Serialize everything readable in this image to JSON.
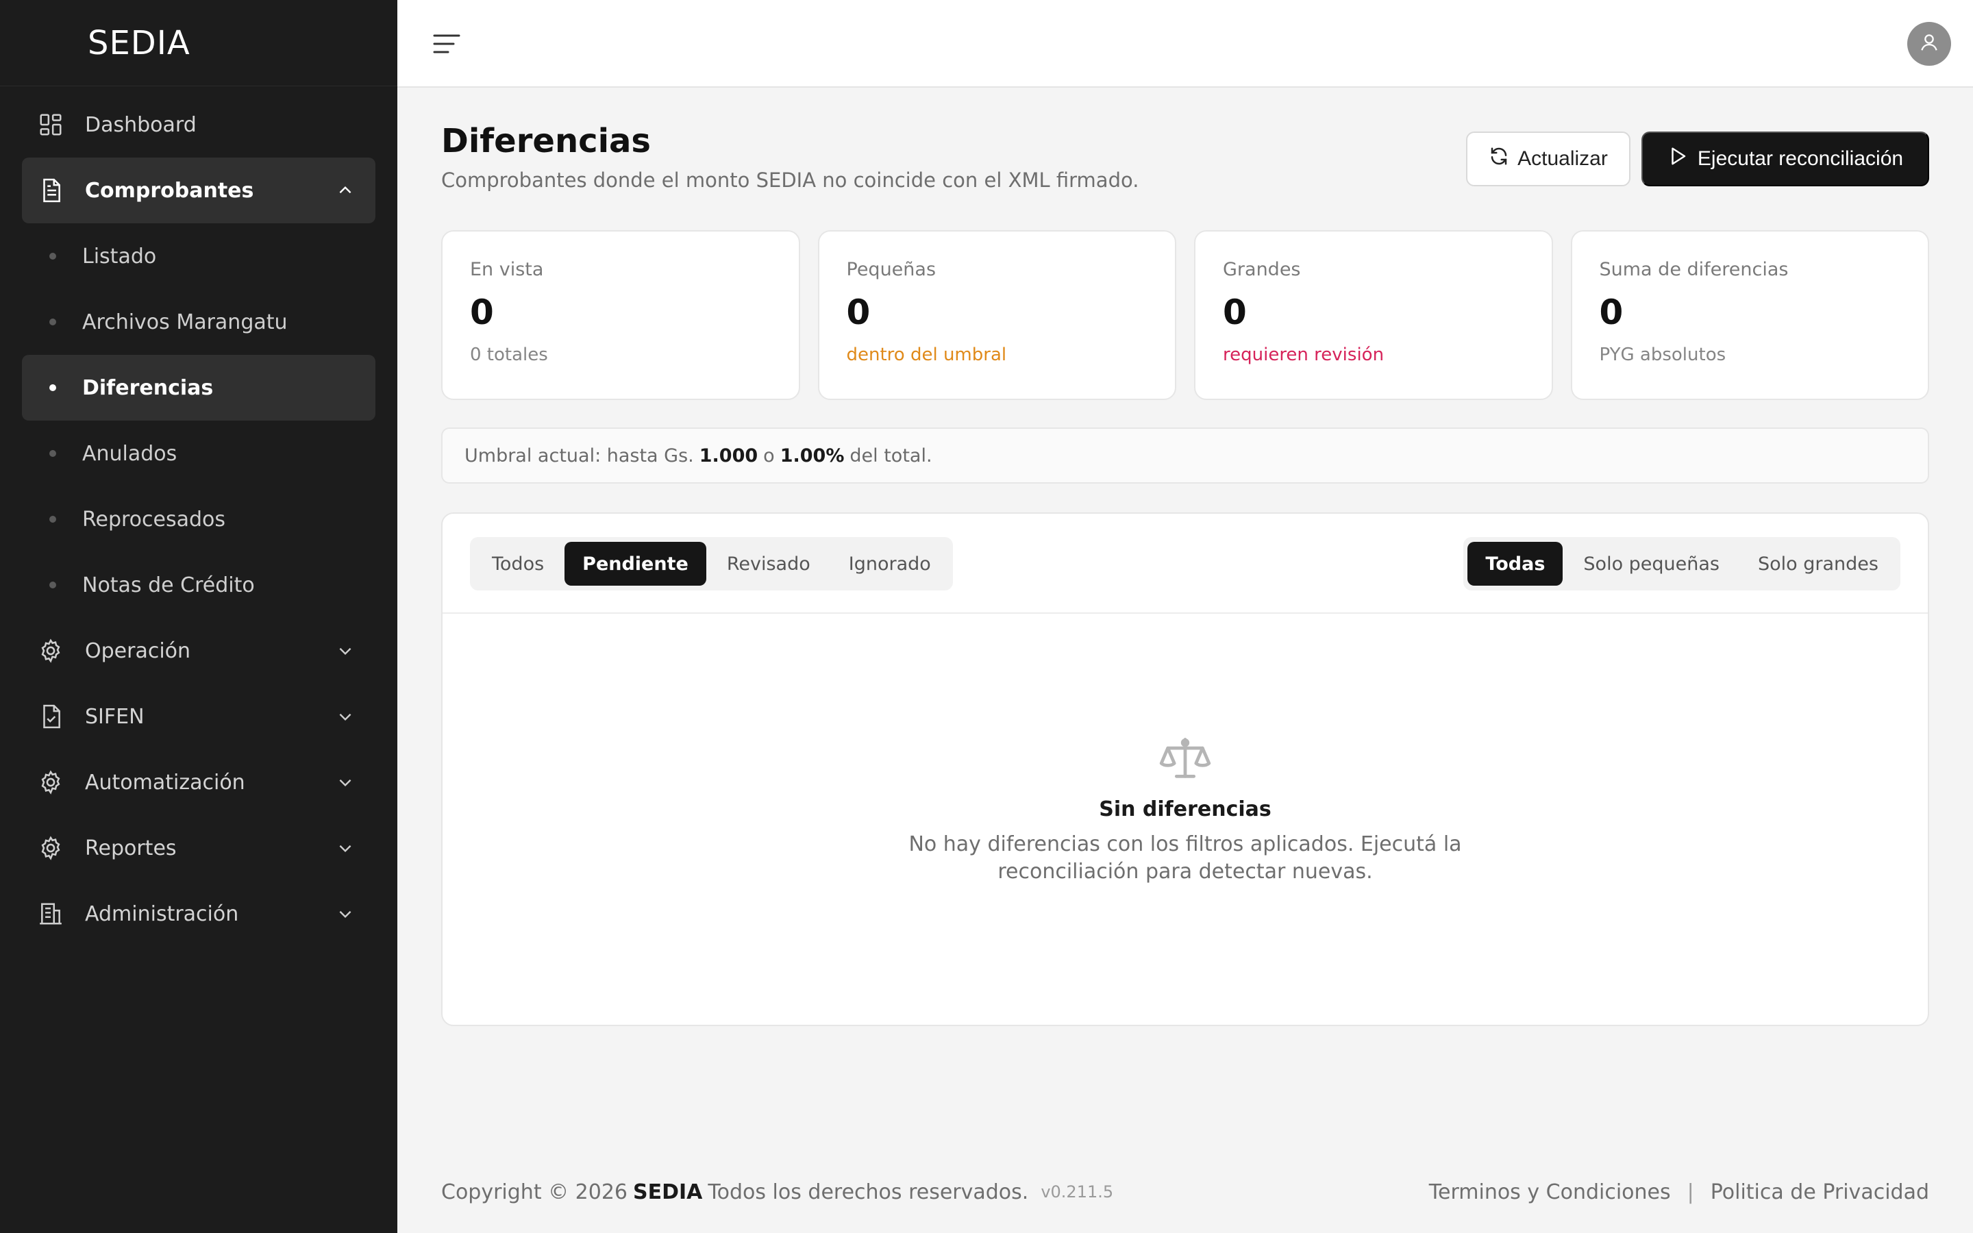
{
  "sidebar": {
    "brand": "SEDIA",
    "items": {
      "dashboard": "Dashboard",
      "comprobantes": "Comprobantes",
      "operacion": "Operación",
      "sifen": "SIFEN",
      "automatizacion": "Automatización",
      "reportes": "Reportes",
      "administracion": "Administración"
    },
    "sub_items": [
      {
        "label": "Listado",
        "active": false
      },
      {
        "label": "Archivos Marangatu",
        "active": false
      },
      {
        "label": "Diferencias",
        "active": true
      },
      {
        "label": "Anulados",
        "active": false
      },
      {
        "label": "Reprocesados",
        "active": false
      },
      {
        "label": "Notas de Crédito",
        "active": false
      }
    ],
    "icons": {
      "dashboard": "grid-icon",
      "comprobantes": "document-icon",
      "operacion": "gear-icon",
      "sifen": "file-check-icon",
      "automatizacion": "gear-icon",
      "reportes": "gear-icon",
      "administracion": "building-icon"
    }
  },
  "topbar": {
    "menu_icon": "hamburger-icon",
    "avatar_icon": "user-icon"
  },
  "page": {
    "title": "Diferencias",
    "subtitle": "Comprobantes donde el monto SEDIA no coincide con el XML firmado.",
    "refresh_label": "Actualizar",
    "run_label": "Ejecutar reconciliación"
  },
  "cards": [
    {
      "label": "En vista",
      "value": "0",
      "note": "0 totales",
      "tone": "muted"
    },
    {
      "label": "Pequeñas",
      "value": "0",
      "note": "dentro del umbral",
      "tone": "orange"
    },
    {
      "label": "Grandes",
      "value": "0",
      "note": "requieren revisión",
      "tone": "red"
    },
    {
      "label": "Suma de diferencias",
      "value": "0",
      "note": "PYG absolutos",
      "tone": "muted"
    }
  ],
  "threshold": {
    "prefix": "Umbral actual: hasta Gs.",
    "amount": "1.000",
    "middle": "o",
    "percent": "1.00%",
    "suffix": "del total."
  },
  "filters": {
    "status": [
      "Todos",
      "Pendiente",
      "Revisado",
      "Ignorado"
    ],
    "status_selected": "Pendiente",
    "size": [
      "Todas",
      "Solo pequeñas",
      "Solo grandes"
    ],
    "size_selected": "Todas"
  },
  "empty_state": {
    "icon": "scale-icon",
    "title": "Sin diferencias",
    "description": "No hay diferencias con los filtros aplicados. Ejecutá la reconciliación para detectar nuevas."
  },
  "footer": {
    "copyright": "Copyright © 2026",
    "brand": "SEDIA",
    "rights": "Todos los derechos reservados.",
    "version": "v0.211.5",
    "terms": "Terminos y Condiciones",
    "separator": "|",
    "privacy": "Politica de Privacidad"
  },
  "colors": {
    "sidebar_bg": "#1c1c1c",
    "accent_dark": "#161616",
    "warning": "#e08a1a",
    "danger": "#d6235a"
  }
}
